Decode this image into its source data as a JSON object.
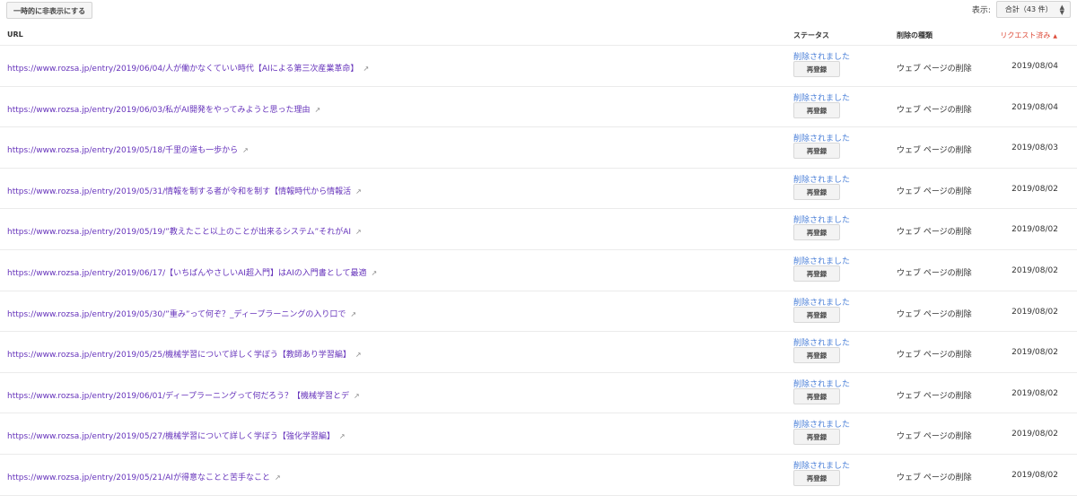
{
  "toolbar": {
    "hide_button_label": "一時的に非表示にする",
    "display_label": "表示:",
    "display_value": "合計（43 件）"
  },
  "table": {
    "columns": {
      "url": "URL",
      "status": "ステータス",
      "type": "削除の種類",
      "requested": "リクエスト済み"
    },
    "rows": [
      {
        "url": "https://www.rozsa.jp/entry/2019/06/04/人が働かなくていい時代【AIによる第三次産業革命】",
        "status": "削除されました",
        "button": "再登録",
        "type": "ウェブ ページの削除",
        "date": "2019/08/04"
      },
      {
        "url": "https://www.rozsa.jp/entry/2019/06/03/私がAI開発をやってみようと思った理由",
        "status": "削除されました",
        "button": "再登録",
        "type": "ウェブ ページの削除",
        "date": "2019/08/04"
      },
      {
        "url": "https://www.rozsa.jp/entry/2019/05/18/千里の道も一歩から",
        "status": "削除されました",
        "button": "再登録",
        "type": "ウェブ ページの削除",
        "date": "2019/08/03"
      },
      {
        "url": "https://www.rozsa.jp/entry/2019/05/31/情報を制する者が令和を制す【情報時代から情報活",
        "status": "削除されました",
        "button": "再登録",
        "type": "ウェブ ページの削除",
        "date": "2019/08/02"
      },
      {
        "url": "https://www.rozsa.jp/entry/2019/05/19/”教えたこと以上のことが出来るシステム”それがAI",
        "status": "削除されました",
        "button": "再登録",
        "type": "ウェブ ページの削除",
        "date": "2019/08/02"
      },
      {
        "url": "https://www.rozsa.jp/entry/2019/06/17/【いちばんやさしいAI超入門】はAIの入門書として最適",
        "status": "削除されました",
        "button": "再登録",
        "type": "ウェブ ページの削除",
        "date": "2019/08/02"
      },
      {
        "url": "https://www.rozsa.jp/entry/2019/05/30/”重み”って何ぞ？_ディープラーニングの入り口で",
        "status": "削除されました",
        "button": "再登録",
        "type": "ウェブ ページの削除",
        "date": "2019/08/02"
      },
      {
        "url": "https://www.rozsa.jp/entry/2019/05/25/機械学習について詳しく学ぼう【教師あり学習編】",
        "status": "削除されました",
        "button": "再登録",
        "type": "ウェブ ページの削除",
        "date": "2019/08/02"
      },
      {
        "url": "https://www.rozsa.jp/entry/2019/06/01/ディープラーニングって何だろう？【機械学習とデ",
        "status": "削除されました",
        "button": "再登録",
        "type": "ウェブ ページの削除",
        "date": "2019/08/02"
      },
      {
        "url": "https://www.rozsa.jp/entry/2019/05/27/機械学習について詳しく学ぼう【強化学習編】",
        "status": "削除されました",
        "button": "再登録",
        "type": "ウェブ ページの削除",
        "date": "2019/08/02"
      },
      {
        "url": "https://www.rozsa.jp/entry/2019/05/21/AIが得意なことと苦手なこと",
        "status": "削除されました",
        "button": "再登録",
        "type": "ウェブ ページの削除",
        "date": "2019/08/02"
      }
    ]
  },
  "colors": {
    "link": "#6633bb",
    "status": "#4a7fd8",
    "sort_active": "#dd4b39"
  },
  "icons": {
    "external": "external-link-icon",
    "sort": "sort-ascending-icon",
    "select": "select-arrows-icon"
  }
}
